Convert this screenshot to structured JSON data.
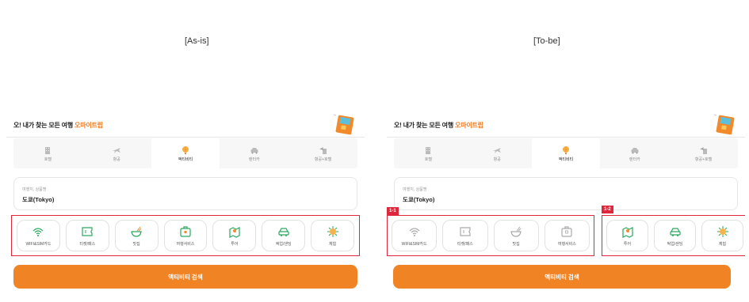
{
  "captions": {
    "as_is": "[As-is]",
    "to_be": "[To-be]"
  },
  "header": {
    "title_main": "오! 내가 찾는 모든 여행 ",
    "title_accent": "오마이트립"
  },
  "tabs": [
    {
      "label": "호텔",
      "icon": "hotel-icon"
    },
    {
      "label": "항공",
      "icon": "airplane-icon"
    },
    {
      "label": "액티비티",
      "icon": "balloon-icon",
      "active": true
    },
    {
      "label": "렌터카",
      "icon": "car-icon"
    },
    {
      "label": "항공+호텔",
      "icon": "airplane-hotel-icon"
    }
  ],
  "destination": {
    "label": "여행지, 상품명",
    "value": "도쿄(Tokyo)"
  },
  "categories": [
    {
      "label": "WIFI&SIM카드",
      "icon": "wifi-icon"
    },
    {
      "label": "티켓/패스",
      "icon": "ticket-icon"
    },
    {
      "label": "맛집",
      "icon": "bowl-icon"
    },
    {
      "label": "여행서비스",
      "icon": "luggage-icon"
    },
    {
      "label": "투어",
      "icon": "map-pin-icon"
    },
    {
      "label": "픽업/샌딩",
      "icon": "car-icon"
    },
    {
      "label": "체험",
      "icon": "sparkle-icon"
    }
  ],
  "badges": {
    "group1": "1-1",
    "group2": "1-2"
  },
  "search_button": "액티비티 검색",
  "colors": {
    "accent": "#ef7a1f",
    "button": "#f08425",
    "highlight": "#e0263a"
  }
}
